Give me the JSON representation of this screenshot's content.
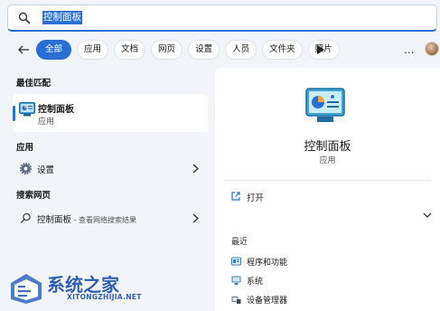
{
  "search": {
    "query": "控制面板"
  },
  "filters": [
    "全部",
    "应用",
    "文档",
    "网页",
    "设置",
    "人员",
    "文件夹",
    "照片"
  ],
  "more_label": "...",
  "left": {
    "best_match_header": "最佳匹配",
    "best_match": {
      "title": "控制面板",
      "subtitle": "应用"
    },
    "apps_header": "应用",
    "apps": [
      {
        "label": "设置"
      }
    ],
    "web_header": "搜索网页",
    "web": [
      {
        "label": "控制面板",
        "desc": " - 查看网络搜索结果"
      }
    ]
  },
  "detail": {
    "title": "控制面板",
    "subtitle": "应用",
    "open_label": "打开",
    "recent_header": "最近",
    "recent": [
      {
        "label": "程序和功能"
      },
      {
        "label": "系统"
      },
      {
        "label": "设备管理器"
      }
    ]
  },
  "watermark": {
    "title": "系统之家",
    "url": "XITONGZHIJIA.NET"
  },
  "colors": {
    "accent": "#2a6fd6",
    "watermark": "#2f5fb5",
    "background": "#f1f4f9"
  }
}
